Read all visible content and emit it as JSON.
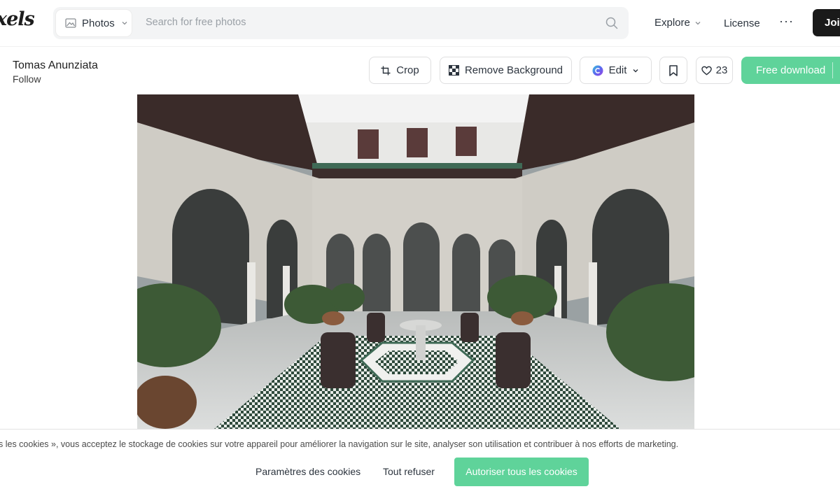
{
  "header": {
    "logo_text": "xels",
    "search_type_label": "Photos",
    "search_placeholder": "Search for free photos",
    "nav_explore": "Explore",
    "nav_license": "License",
    "nav_more": "···",
    "join_label": "Join"
  },
  "photo_page": {
    "author_name": "Tomas Anunziata",
    "follow_label": "Follow",
    "crop_label": "Crop",
    "remove_bg_label": "Remove Background",
    "edit_label": "Edit",
    "like_count": "23",
    "download_label": "Free download"
  },
  "cookie_banner": {
    "text": "s les cookies », vous acceptez le stockage de cookies sur votre appareil pour améliorer la navigation sur le site, analyser son utilisation et contribuer à nos efforts de marketing.",
    "settings_label": "Paramètres des cookies",
    "refuse_label": "Tout refuser",
    "accept_label": "Autoriser tous les cookies"
  },
  "colors": {
    "accent_green": "#5fd39a",
    "join_bg": "#1a1a1a",
    "search_bg": "#f3f4f5"
  },
  "icons": [
    "image-icon",
    "chevron-down-icon",
    "search-icon",
    "crop-icon",
    "checkerboard-icon",
    "edit-color-icon",
    "bookmark-icon",
    "heart-icon"
  ]
}
